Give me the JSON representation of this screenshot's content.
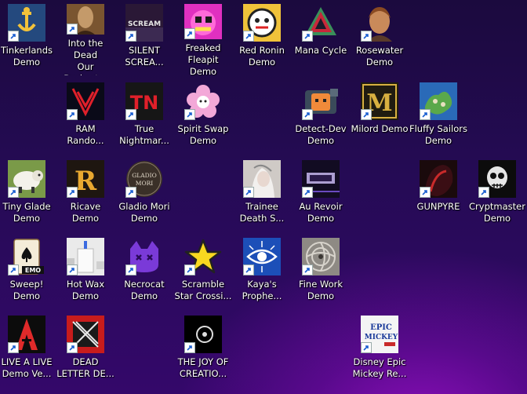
{
  "desktop": {
    "icons": [
      {
        "label": "Tinkerlands\nDemo",
        "icon": "tinkerlands-icon"
      },
      {
        "label": "Into the Dead\nOur Darkest...",
        "icon": "into-the-dead-icon"
      },
      {
        "label": "SILENT\nSCREA...",
        "icon": "silent-scream-icon",
        "tile_text": "SCREAM"
      },
      {
        "label": "Freaked\nFleapit Demo",
        "icon": "freaked-fleapit-icon"
      },
      {
        "label": "Red Ronin\nDemo",
        "icon": "red-ronin-icon"
      },
      {
        "label": "Mana Cycle",
        "icon": "mana-cycle-icon"
      },
      {
        "label": "Rosewater\nDemo",
        "icon": "rosewater-icon"
      },
      {
        "label": "RAM\nRando...",
        "icon": "ram-rando-icon"
      },
      {
        "label": "True\nNightmar...",
        "icon": "true-nightmare-icon",
        "tile_text": "TN"
      },
      {
        "label": "Spirit Swap\nDemo",
        "icon": "spirit-swap-icon"
      },
      {
        "label": "Detect-Dev\nDemo",
        "icon": "detect-dev-icon"
      },
      {
        "label": "Milord Demo",
        "icon": "milord-icon",
        "tile_text": "M"
      },
      {
        "label": "Fluffy Sailors\nDemo",
        "icon": "fluffy-sailors-icon"
      },
      {
        "label": "Tiny Glade\nDemo",
        "icon": "tiny-glade-icon"
      },
      {
        "label": "Ricave Demo",
        "icon": "ricave-icon",
        "tile_text": "R"
      },
      {
        "label": "Gladio Mori\nDemo",
        "icon": "gladio-mori-icon",
        "tile_text": "GLADIO\nMORI"
      },
      {
        "label": "Trainee\nDeath S...",
        "icon": "trainee-death-icon"
      },
      {
        "label": "Au Revoir\nDemo",
        "icon": "au-revoir-icon"
      },
      {
        "label": "GUNPYRE",
        "icon": "gunpyre-icon"
      },
      {
        "label": "Cryptmaster\nDemo",
        "icon": "cryptmaster-icon"
      },
      {
        "label": "Sweep!\nDemo",
        "icon": "sweep-icon",
        "tile_text": "EMO"
      },
      {
        "label": "Hot Wax\nDemo",
        "icon": "hot-wax-icon"
      },
      {
        "label": "Necrocat\nDemo",
        "icon": "necrocat-icon"
      },
      {
        "label": "Scramble\nStar Crossi...",
        "icon": "scramble-star-icon"
      },
      {
        "label": "Kaya's\nProphe...",
        "icon": "kayas-prophecy-icon"
      },
      {
        "label": "Fine Work\nDemo",
        "icon": "fine-work-icon"
      },
      {
        "label": "LIVE A LIVE\nDemo Ve...",
        "icon": "live-a-live-icon"
      },
      {
        "label": "DEAD\nLETTER DE...",
        "icon": "dead-letter-icon"
      },
      {
        "label": "THE JOY OF\nCREATIO...",
        "icon": "joy-of-creation-icon"
      },
      {
        "label": "Disney Epic\nMickey Re...",
        "icon": "epic-mickey-icon",
        "tile_text": "EPIC\nMICKEY"
      }
    ]
  },
  "colors": {
    "shortcut_arrow": "#1a5fd0",
    "label_text": "#ffffff"
  }
}
